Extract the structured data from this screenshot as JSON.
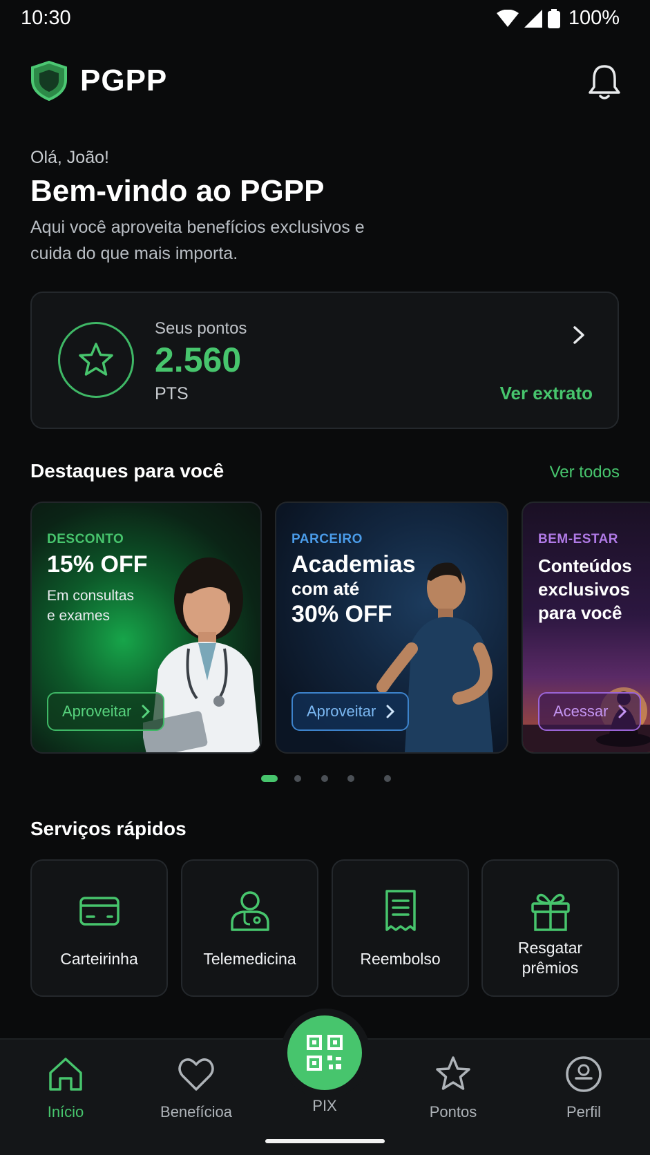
{
  "status_bar": {
    "time": "10:30",
    "battery": "100%"
  },
  "header": {
    "brand": "PGPP"
  },
  "greeting": {
    "hello": "Olá, João!",
    "title": "Bem-vindo ao PGPP",
    "subtitle": "Aqui você aproveita benefícios exclusivos e cuida do que mais importa."
  },
  "points": {
    "label": "Seus pontos",
    "value": "2.560",
    "unit": "PTS",
    "link": "Ver extrato"
  },
  "highlights": {
    "title": "Destaques para você",
    "link": "Ver todos",
    "cards": [
      {
        "tag": "DESCONTO",
        "title": "15% OFF",
        "desc_line1": "Em consultas",
        "desc_line2": "e exames",
        "cta": "Aproveitar",
        "accent": "#47c56d"
      },
      {
        "tag": "PARCEIRO",
        "title": "Academias",
        "desc_line1": "com até",
        "title2": "30% OFF",
        "cta": "Aproveitar",
        "accent": "#4a9be8"
      },
      {
        "tag": "BEM-ESTAR",
        "title_line1": "Conteúdos",
        "title_line2": "exclusivos",
        "title_line3": "para você",
        "cta": "Acessar",
        "accent": "#b07ae6"
      }
    ],
    "pager": {
      "total": 5,
      "active": 1
    }
  },
  "services": {
    "title": "Serviços rápidos",
    "items": [
      {
        "label": "Carteirinha",
        "icon": "card-icon"
      },
      {
        "label": "Telemedicina",
        "icon": "doctor-icon"
      },
      {
        "label": "Reembolso",
        "icon": "receipt-icon"
      },
      {
        "label_line1": "Resgatar",
        "label_line2": "prêmios",
        "icon": "gift-icon"
      }
    ]
  },
  "nav": {
    "items": [
      {
        "label": "Início",
        "icon": "home-icon",
        "active": true
      },
      {
        "label": "Benefícioa",
        "icon": "heart-icon"
      },
      {
        "label": "PIX",
        "icon": "qr-code-icon"
      },
      {
        "label": "Pontos",
        "icon": "star-icon"
      },
      {
        "label": "Perfil",
        "icon": "profile-icon"
      }
    ]
  },
  "colors": {
    "accent": "#47c56d",
    "background": "#0a0b0c",
    "card": "#121416"
  }
}
